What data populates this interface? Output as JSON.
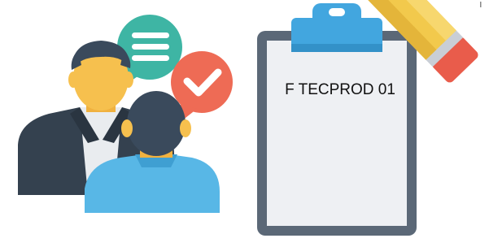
{
  "clipboard": {
    "label": "F TECPROD 01"
  },
  "icons": {
    "people": "conversation-people-icon",
    "message_bubble": "message-lines-bubble-icon",
    "check_bubble": "checkmark-bubble-icon",
    "clipboard": "clipboard-icon",
    "pencil": "pencil-icon"
  },
  "colors": {
    "bubble_teal": "#3eb5a4",
    "bubble_red": "#ee6b55",
    "skin": "#f6c04e",
    "hair": "#3a4a5c",
    "suit_dark": "#34414f",
    "shirt_light": "#e9ecef",
    "shirt_blue": "#58b7e6",
    "clipboard_frame": "#5b6877",
    "clipboard_paper": "#eef0f3",
    "clip_blue": "#42a6df",
    "pencil_yellow": "#f2c94c",
    "pencil_tip_red": "#e95c4b"
  }
}
